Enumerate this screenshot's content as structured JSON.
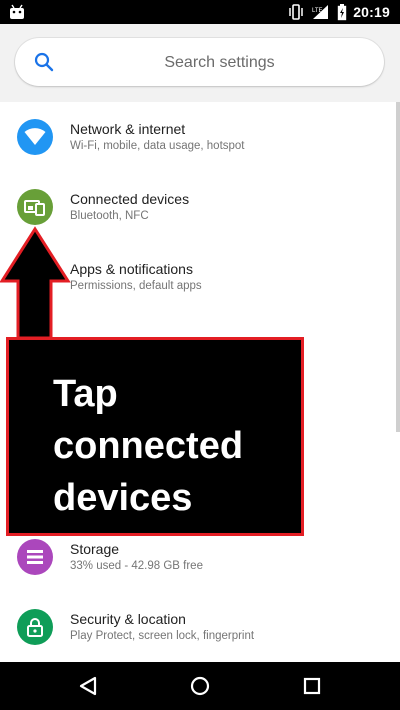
{
  "status_bar": {
    "time": "20:19",
    "network_label": "LTE",
    "icons": [
      "android-notification-icon",
      "vibrate-icon",
      "signal-icon",
      "battery-icon"
    ]
  },
  "search": {
    "placeholder": "Search settings"
  },
  "settings": [
    {
      "title": "Network & internet",
      "subtitle": "Wi-Fi, mobile, data usage, hotspot",
      "icon": "wifi-icon",
      "color": "#2196f3"
    },
    {
      "title": "Connected devices",
      "subtitle": "Bluetooth, NFC",
      "icon": "devices-icon",
      "color": "#689f38"
    },
    {
      "title": "Apps & notifications",
      "subtitle": "Permissions, default apps",
      "icon": "apps-icon",
      "color": "#ff9800"
    },
    {
      "title": "Storage",
      "subtitle": "33% used - 42.98 GB free",
      "icon": "storage-icon",
      "color": "#ab47bc"
    },
    {
      "title": "Security & location",
      "subtitle": "Play Protect, screen lock, fingerprint",
      "icon": "lock-icon",
      "color": "#0f9d58"
    }
  ],
  "overlay": {
    "lines": [
      "Tap",
      "connected",
      "devices"
    ],
    "border_color": "#e31e24"
  },
  "nav_bar": {
    "buttons": [
      "back-icon",
      "home-icon",
      "recents-icon"
    ]
  }
}
